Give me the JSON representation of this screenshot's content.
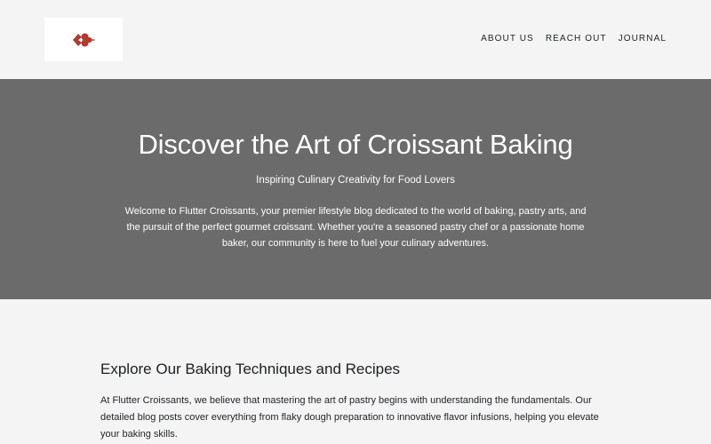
{
  "brand": {
    "logo_icon": "croissant-logo-icon",
    "accent": "#c0392b"
  },
  "nav": {
    "items": [
      {
        "label": "ABOUT US"
      },
      {
        "label": "REACH OUT"
      },
      {
        "label": "JOURNAL"
      }
    ]
  },
  "hero": {
    "title": "Discover the Art of Croissant Baking",
    "tagline": "Inspiring Culinary Creativity for Food Lovers",
    "intro": "Welcome to Flutter Croissants, your premier lifestyle blog dedicated to the world of baking, pastry arts, and the pursuit of the perfect gourmet croissant. Whether you're a seasoned pastry chef or a passionate home baker, our community is here to fuel your culinary adventures.",
    "background": "#6b6b6b"
  },
  "section": {
    "heading": "Explore Our Baking Techniques and Recipes",
    "body": "At Flutter Croissants, we believe that mastering the art of pastry begins with understanding the fundamentals. Our detailed blog posts cover everything from flaky dough preparation to innovative flavor infusions, helping you elevate your baking skills."
  }
}
